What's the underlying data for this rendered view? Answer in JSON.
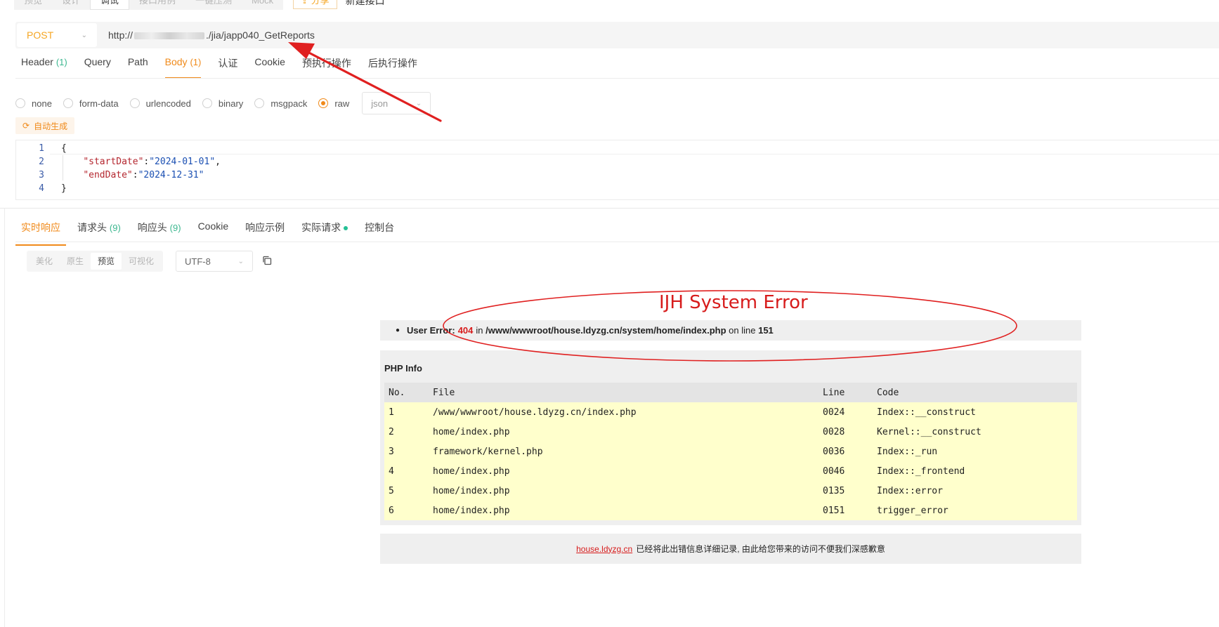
{
  "top_tabs": [
    "预览",
    "设计",
    "调试",
    "接口用例",
    "一键压测",
    "Mock"
  ],
  "top_active_tab": "调试",
  "share_label": "分享",
  "new_api_label": "新建接口",
  "request": {
    "method": "POST",
    "url_prefix": "http://",
    "url_suffix": "./jia/japp040_GetReports"
  },
  "req_tabs": [
    {
      "label": "Header",
      "count": "(1)"
    },
    {
      "label": "Query",
      "count": ""
    },
    {
      "label": "Path",
      "count": ""
    },
    {
      "label": "Body",
      "count": "(1)"
    },
    {
      "label": "认证",
      "count": ""
    },
    {
      "label": "Cookie",
      "count": ""
    },
    {
      "label": "预执行操作",
      "count": ""
    },
    {
      "label": "后执行操作",
      "count": ""
    }
  ],
  "body_types": [
    "none",
    "form-data",
    "urlencoded",
    "binary",
    "msgpack",
    "raw"
  ],
  "body_type_selected": "raw",
  "body_format": "json",
  "auto_generate_label": "自动生成",
  "code": {
    "line_numbers": [
      "1",
      "2",
      "3",
      "4"
    ],
    "open": "{",
    "close": "}",
    "key1": "\"startDate\"",
    "val1": "\"2024-01-01\"",
    "key2": "\"endDate\"",
    "val2": "\"2024-12-31\""
  },
  "resp_tabs": [
    {
      "label": "实时响应",
      "count": ""
    },
    {
      "label": "请求头",
      "count": "(9)"
    },
    {
      "label": "响应头",
      "count": "(9)"
    },
    {
      "label": "Cookie",
      "count": ""
    },
    {
      "label": "响应示例",
      "count": ""
    },
    {
      "label": "实际请求",
      "count": ""
    },
    {
      "label": "控制台",
      "count": ""
    }
  ],
  "view_modes": [
    "美化",
    "原生",
    "预览",
    "可视化"
  ],
  "view_mode_active": "预览",
  "encoding": "UTF-8",
  "error_page": {
    "title": "IJH System Error",
    "error_label": "User Error:",
    "error_code": "404",
    "in_text": "in",
    "error_path": "/www/wwwroot/house.ldyzg.cn/system/home/index.php",
    "on_line_text": "on line",
    "error_line": "151",
    "php_info_title": "PHP Info",
    "table_headers": [
      "No.",
      "File",
      "Line",
      "Code"
    ],
    "table_rows": [
      [
        "1",
        "/www/wwwroot/house.ldyzg.cn/index.php",
        "0024",
        "Index::__construct"
      ],
      [
        "2",
        "home/index.php",
        "0028",
        "Kernel::__construct"
      ],
      [
        "3",
        "framework/kernel.php",
        "0036",
        "Index::_run"
      ],
      [
        "4",
        "home/index.php",
        "0046",
        "Index::_frontend"
      ],
      [
        "5",
        "home/index.php",
        "0135",
        "Index::error"
      ],
      [
        "6",
        "home/index.php",
        "0151",
        "trigger_error"
      ]
    ],
    "footer_site": "house.ldyzg.cn",
    "footer_text": "已经将此出错信息详细记录, 由此给您带来的访问不便我们深感歉意"
  },
  "colors": {
    "accent": "#f08a1a",
    "error_red": "#d71c1c",
    "count_green": "#3bb78f",
    "table_row_bg": "#ffffcc",
    "annotation_red": "#e02020"
  }
}
